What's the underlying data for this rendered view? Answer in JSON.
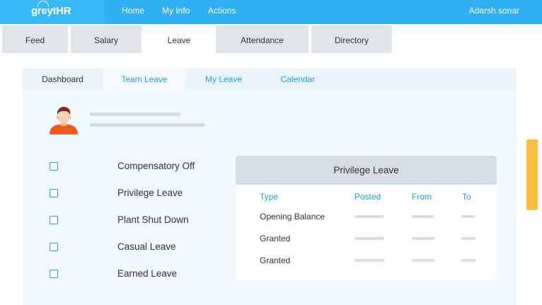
{
  "topbar": {
    "logo": "greytHR",
    "nav": [
      "Home",
      "My Info",
      "Actions"
    ],
    "user": "Adarsh sonar"
  },
  "tabs": [
    "Feed",
    "Salary",
    "Leave",
    "Attendance",
    "Directory"
  ],
  "subtabs": [
    "Dashboard",
    "Team Leave",
    "My Leave",
    "Calendar"
  ],
  "leave_types": [
    "Compensatory Off",
    "Privilege Leave",
    "Plant Shut Down",
    "Casual Leave",
    "Earned Leave"
  ],
  "card": {
    "title": "Privilege Leave",
    "columns": [
      "Type",
      "Posted",
      "From",
      "To"
    ],
    "rows": [
      "Opening Balance",
      "Granted",
      "Granted"
    ]
  },
  "colors": {
    "topbar": "#2eb0f2",
    "accent": "#1ba3e8",
    "scrollbar": "#ffbf3c"
  }
}
